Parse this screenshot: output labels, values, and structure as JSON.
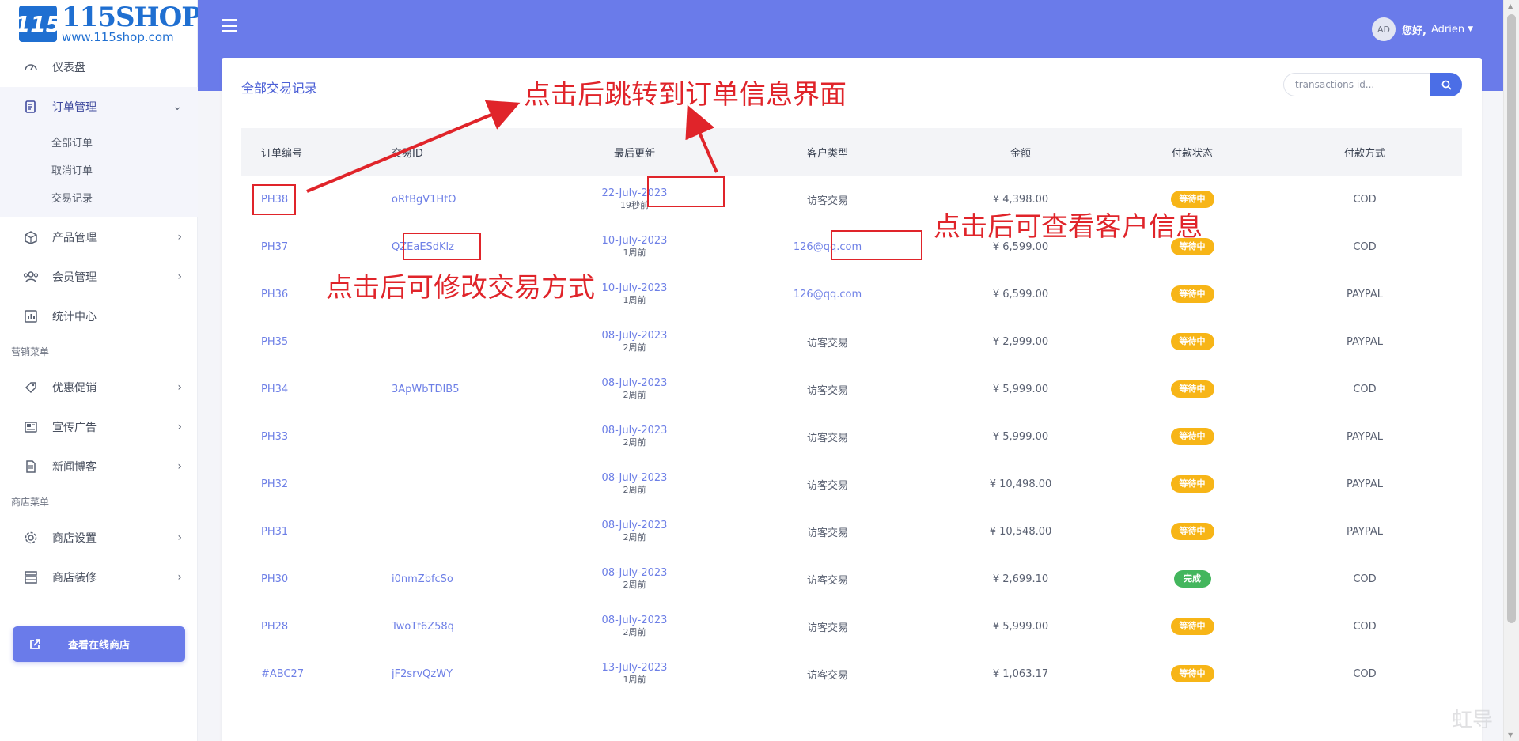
{
  "brand": {
    "badge": "115",
    "name": "115SHOP",
    "url": "www.115shop.com"
  },
  "sidebar": {
    "items": [
      {
        "label": "仪表盘",
        "icon": "dashboard-icon"
      },
      {
        "label": "订单管理",
        "icon": "orders-icon"
      },
      {
        "label": "产品管理",
        "icon": "products-icon"
      },
      {
        "label": "会员管理",
        "icon": "members-icon"
      },
      {
        "label": "统计中心",
        "icon": "stats-icon"
      },
      {
        "label": "优惠促销",
        "icon": "promo-icon"
      },
      {
        "label": "宣传广告",
        "icon": "ads-icon"
      },
      {
        "label": "新闻博客",
        "icon": "blog-icon"
      },
      {
        "label": "商店设置",
        "icon": "gear-icon"
      },
      {
        "label": "商店装修",
        "icon": "decor-icon"
      }
    ],
    "sub_items": [
      "全部订单",
      "取消订单",
      "交易记录"
    ],
    "sections": [
      "营销菜单",
      "商店菜单"
    ],
    "store_button": "查看在线商店"
  },
  "header": {
    "avatar": "AD",
    "greeting": "您好,",
    "username": "Adrien"
  },
  "main": {
    "title": "全部交易记录",
    "search_placeholder": "transactions id...",
    "columns": [
      "订单编号",
      "交易ID",
      "最后更新",
      "客户类型",
      "金额",
      "付款状态",
      "付款方式"
    ],
    "rows": [
      {
        "order": "PH38",
        "txn": "oRtBgV1HtO",
        "date": "22-July-2023",
        "ago": "19秒前",
        "customer": "访客交易",
        "amount": "¥ 4,398.00",
        "status": "等待中",
        "method": "COD"
      },
      {
        "order": "PH37",
        "txn": "QZEaESdKlz",
        "date": "10-July-2023",
        "ago": "1周前",
        "customer": "126@qq.com",
        "amount": "¥ 6,599.00",
        "status": "等待中",
        "method": "COD"
      },
      {
        "order": "PH36",
        "txn": "",
        "date": "10-July-2023",
        "ago": "1周前",
        "customer": "126@qq.com",
        "amount": "¥ 6,599.00",
        "status": "等待中",
        "method": "PAYPAL"
      },
      {
        "order": "PH35",
        "txn": "",
        "date": "08-July-2023",
        "ago": "2周前",
        "customer": "访客交易",
        "amount": "¥ 2,999.00",
        "status": "等待中",
        "method": "PAYPAL"
      },
      {
        "order": "PH34",
        "txn": "3ApWbTDIB5",
        "date": "08-July-2023",
        "ago": "2周前",
        "customer": "访客交易",
        "amount": "¥ 5,999.00",
        "status": "等待中",
        "method": "COD"
      },
      {
        "order": "PH33",
        "txn": "",
        "date": "08-July-2023",
        "ago": "2周前",
        "customer": "访客交易",
        "amount": "¥ 5,999.00",
        "status": "等待中",
        "method": "PAYPAL"
      },
      {
        "order": "PH32",
        "txn": "",
        "date": "08-July-2023",
        "ago": "2周前",
        "customer": "访客交易",
        "amount": "¥ 10,498.00",
        "status": "等待中",
        "method": "PAYPAL"
      },
      {
        "order": "PH31",
        "txn": "",
        "date": "08-July-2023",
        "ago": "2周前",
        "customer": "访客交易",
        "amount": "¥ 10,548.00",
        "status": "等待中",
        "method": "PAYPAL"
      },
      {
        "order": "PH30",
        "txn": "i0nmZbfcSo",
        "date": "08-July-2023",
        "ago": "2周前",
        "customer": "访客交易",
        "amount": "¥ 2,699.10",
        "status": "完成",
        "method": "COD"
      },
      {
        "order": "PH28",
        "txn": "TwoTf6Z58q",
        "date": "08-July-2023",
        "ago": "2周前",
        "customer": "访客交易",
        "amount": "¥ 5,999.00",
        "status": "等待中",
        "method": "COD"
      },
      {
        "order": "#ABC27",
        "txn": "jF2srvQzWY",
        "date": "13-July-2023",
        "ago": "1周前",
        "customer": "访客交易",
        "amount": "¥ 1,063.17",
        "status": "等待中",
        "method": "COD"
      }
    ]
  },
  "annotations": {
    "order_jump": "点击后跳转到订单信息界面",
    "customer_view": "点击后可查看客户信息",
    "txn_edit": "点击后可修改交易方式"
  },
  "colors": {
    "primary": "#6a7bea",
    "link": "#6d7fe6",
    "pending": "#f7b517",
    "done": "#43b65d",
    "annotation": "#e0242a"
  },
  "watermark": "虹导"
}
